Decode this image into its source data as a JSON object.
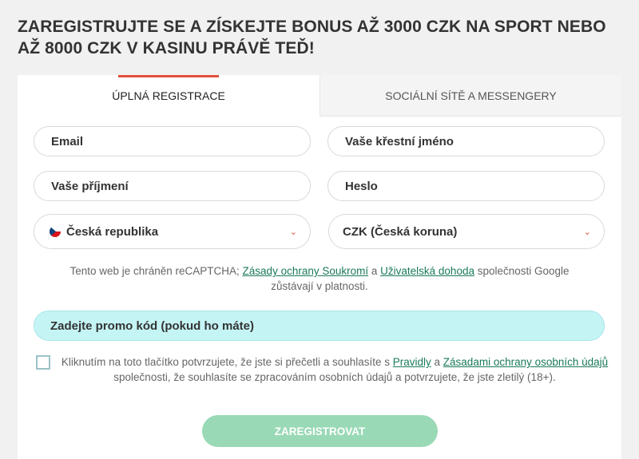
{
  "headline": "ZAREGISTRUJTE SE A ZÍSKEJTE BONUS AŽ 3000 CZK NA SPORT NEBO AŽ 8000 CZK V KASINU PRÁVĚ TEĎ!",
  "tabs": [
    {
      "label": "ÚPLNÁ REGISTRACE",
      "active": true
    },
    {
      "label": "SOCIÁLNÍ SÍTĚ A MESSENGERY",
      "active": false
    }
  ],
  "form": {
    "email_placeholder": "Email",
    "first_name_placeholder": "Vaše křestní jméno",
    "last_name_placeholder": "Vaše příjmení",
    "password_placeholder": "Heslo",
    "country": "Česká republika",
    "currency": "CZK (Česká koruna)",
    "promo_label": "Zadejte promo kód (pokud ho máte)",
    "submit_label": "ZAREGISTROVAT"
  },
  "recaptcha": {
    "text_before": "Tento web je chráněn reCAPTCHA; ",
    "privacy_link": "Zásady ochrany Soukromí",
    "and": " a ",
    "terms_link": "Uživatelská dohoda",
    "text_after": " společnosti Google zůstávají v platnosti."
  },
  "consent": {
    "text_before": "Kliknutím na toto tlačítko potvrzujete, že jste si přečetli a souhlasíte s ",
    "rules_link": "Pravidly",
    "and": " a ",
    "privacy_link": "Zásadami ochrany osobních údajů",
    "text_after": " společnosti, že souhlasíte se zpracováním osobních údajů a potvrzujete, že jste zletilý (18+)."
  },
  "colors": {
    "accent": "#e0503a",
    "promo_bg": "#c5f4f5",
    "submit_bg": "#9ad9b6",
    "link": "#1a7a5a"
  },
  "icons": {
    "select_arrow": "chevron-down-icon",
    "country_flag": "czech-flag-icon"
  }
}
